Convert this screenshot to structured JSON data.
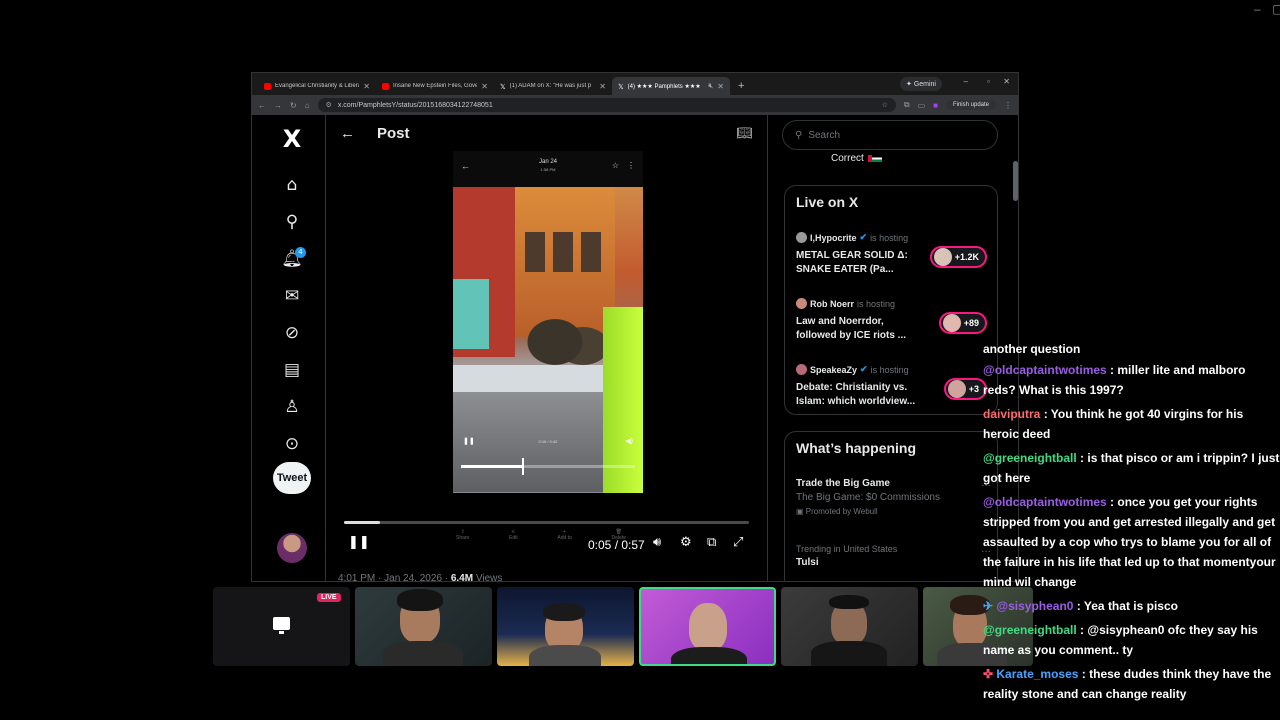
{
  "browser": {
    "tabs": [
      {
        "title": "Evangelical Christianity & Libera",
        "icon": "youtube-icon",
        "color": "#ff0000",
        "active": false
      },
      {
        "title": "Insane New Epstein Files, Gove",
        "icon": "youtube-icon",
        "color": "#ff0000",
        "active": false
      },
      {
        "title": "(1) ADAM on X: \"He was just p",
        "icon": "x-icon",
        "color": "#ffffff",
        "active": false
      },
      {
        "title": "(4) ★★★ Pamphlets ★★★",
        "icon": "x-icon",
        "color": "#ffffff",
        "active": true
      }
    ],
    "gemini_label": "Gemini",
    "url": "x.com/PamphletsY/status/2015168034122748051",
    "finish_update": "Finish update"
  },
  "xnav": {
    "logo": "X",
    "notifications_badge": "4",
    "tweet_label": "Tweet"
  },
  "post": {
    "header_title": "Post",
    "embedded": {
      "date": "Jan 24",
      "time": "1:58 PM",
      "inner_time": "0:16 / 0:42",
      "inner_progress": 0.35
    },
    "ghost_actions": [
      "Share",
      "Edit",
      "Add to",
      "Delete"
    ],
    "video": {
      "current": "0:05",
      "separator": " / ",
      "duration": "0:57",
      "progress": 0.09
    },
    "meta": {
      "timestamp": "4:01 PM · Jan 24, 2026 · ",
      "views_count": "6.4M",
      "views_label": " Views"
    }
  },
  "sidebar": {
    "search_placeholder": "Search",
    "correct_text": "Correct",
    "live": {
      "title": "Live on X",
      "items": [
        {
          "host": "I,Hypocrite",
          "verified": true,
          "hosting": "is hosting",
          "space": "METAL GEAR SOLID Δ: SNAKE EATER (Pa...",
          "listeners": "+1.2K"
        },
        {
          "host": "Rob Noerr",
          "verified": false,
          "hosting": "is hosting",
          "space": "Law and Noerrdor, followed by ICE riots ...",
          "listeners": "+89"
        },
        {
          "host": "SpeakeaZy",
          "verified": true,
          "hosting": "is hosting",
          "space": "Debate: Christianity vs. Islam: which worldview...",
          "listeners": "+3"
        }
      ]
    },
    "happening": {
      "title": "What’s happening",
      "items": [
        {
          "title": "Trade the Big Game",
          "subtitle": "The Big Game: $0 Commissions",
          "promoted": "Promoted by Webull"
        },
        {
          "context": "Trending in United States",
          "topic": "Tulsi"
        }
      ]
    }
  },
  "stream": {
    "live_badge": "LIVE"
  },
  "chat": {
    "messages": [
      {
        "user": "",
        "color": "#ffffff",
        "text": "another question"
      },
      {
        "user": "@oldcaptaintwotimes",
        "color": "#9b5de5",
        "text": " : miller lite and malboro reds? What is this 1997?"
      },
      {
        "user": "daiviputra",
        "color": "#ff6b6b",
        "text": " : You think he got 40 virgins for his heroic deed"
      },
      {
        "user": "@greeneightball",
        "color": "#3ddc84",
        "text": " : is that pisco or am i trippin? I just got here"
      },
      {
        "user": "@oldcaptaintwotimes",
        "color": "#9b5de5",
        "text": " : once you get your rights stripped from you and get arrested illegally and get assaulted by a cop who trys to blame you for all of the failure in his life that led up to that momentyour mind wil change"
      },
      {
        "user": "@sisyphean0",
        "color": "#9b5de5",
        "text": " : Yea that is pisco"
      },
      {
        "user": "@greeneightball",
        "color": "#3ddc84",
        "text": " : @sisyphean0 ofc they say his name as you comment.. ty"
      },
      {
        "user": "Karate_moses",
        "color": "#4aa3ff",
        "text": " : these dudes think they have the reality stone and can change reality"
      }
    ]
  }
}
